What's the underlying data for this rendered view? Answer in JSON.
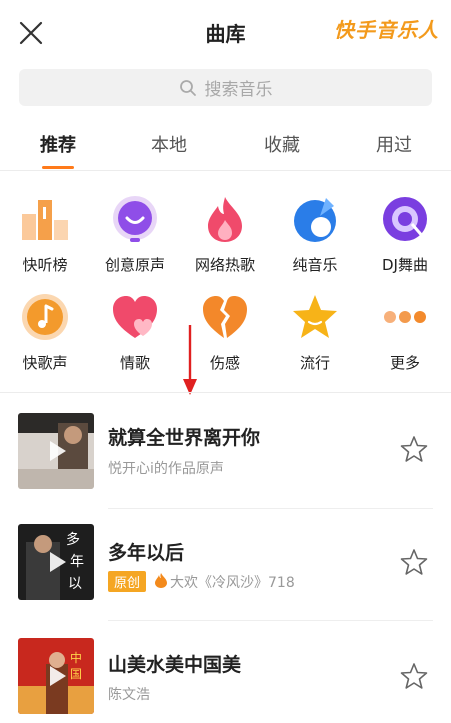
{
  "header": {
    "title": "曲库",
    "brand": "快手音乐人",
    "close_icon": "close-icon"
  },
  "search": {
    "placeholder": "搜索音乐",
    "icon": "search-icon"
  },
  "tabs": [
    {
      "label": "推荐",
      "active": true
    },
    {
      "label": "本地",
      "active": false
    },
    {
      "label": "收藏",
      "active": false
    },
    {
      "label": "用过",
      "active": false
    }
  ],
  "categories": [
    {
      "label": "快听榜",
      "icon": "podium-icon"
    },
    {
      "label": "创意原声",
      "icon": "smile-icon"
    },
    {
      "label": "网络热歌",
      "icon": "flame-icon"
    },
    {
      "label": "纯音乐",
      "icon": "water-drop-icon"
    },
    {
      "label": "DJ舞曲",
      "icon": "vinyl-icon"
    },
    {
      "label": "快歌声",
      "icon": "music-note-icon"
    },
    {
      "label": "情歌",
      "icon": "heart-icon"
    },
    {
      "label": "伤感",
      "icon": "broken-heart-icon"
    },
    {
      "label": "流行",
      "icon": "star-icon"
    },
    {
      "label": "更多",
      "icon": "more-dots-icon"
    }
  ],
  "songs": [
    {
      "title": "就算全世界离开你",
      "subtitle": "悦开心i的作品原声",
      "badge": "",
      "extra": ""
    },
    {
      "title": "多年以后",
      "subtitle": "大欢《冷风沙》718",
      "badge": "原创",
      "extra": "fire-icon"
    },
    {
      "title": "山美水美中国美",
      "subtitle": "陈文浩",
      "badge": "",
      "extra": ""
    }
  ],
  "colors": {
    "accent": "#ff7a1a",
    "brand": "#f39a1c",
    "badge": "#f5a623",
    "annotation_arrow": "#e02020"
  }
}
